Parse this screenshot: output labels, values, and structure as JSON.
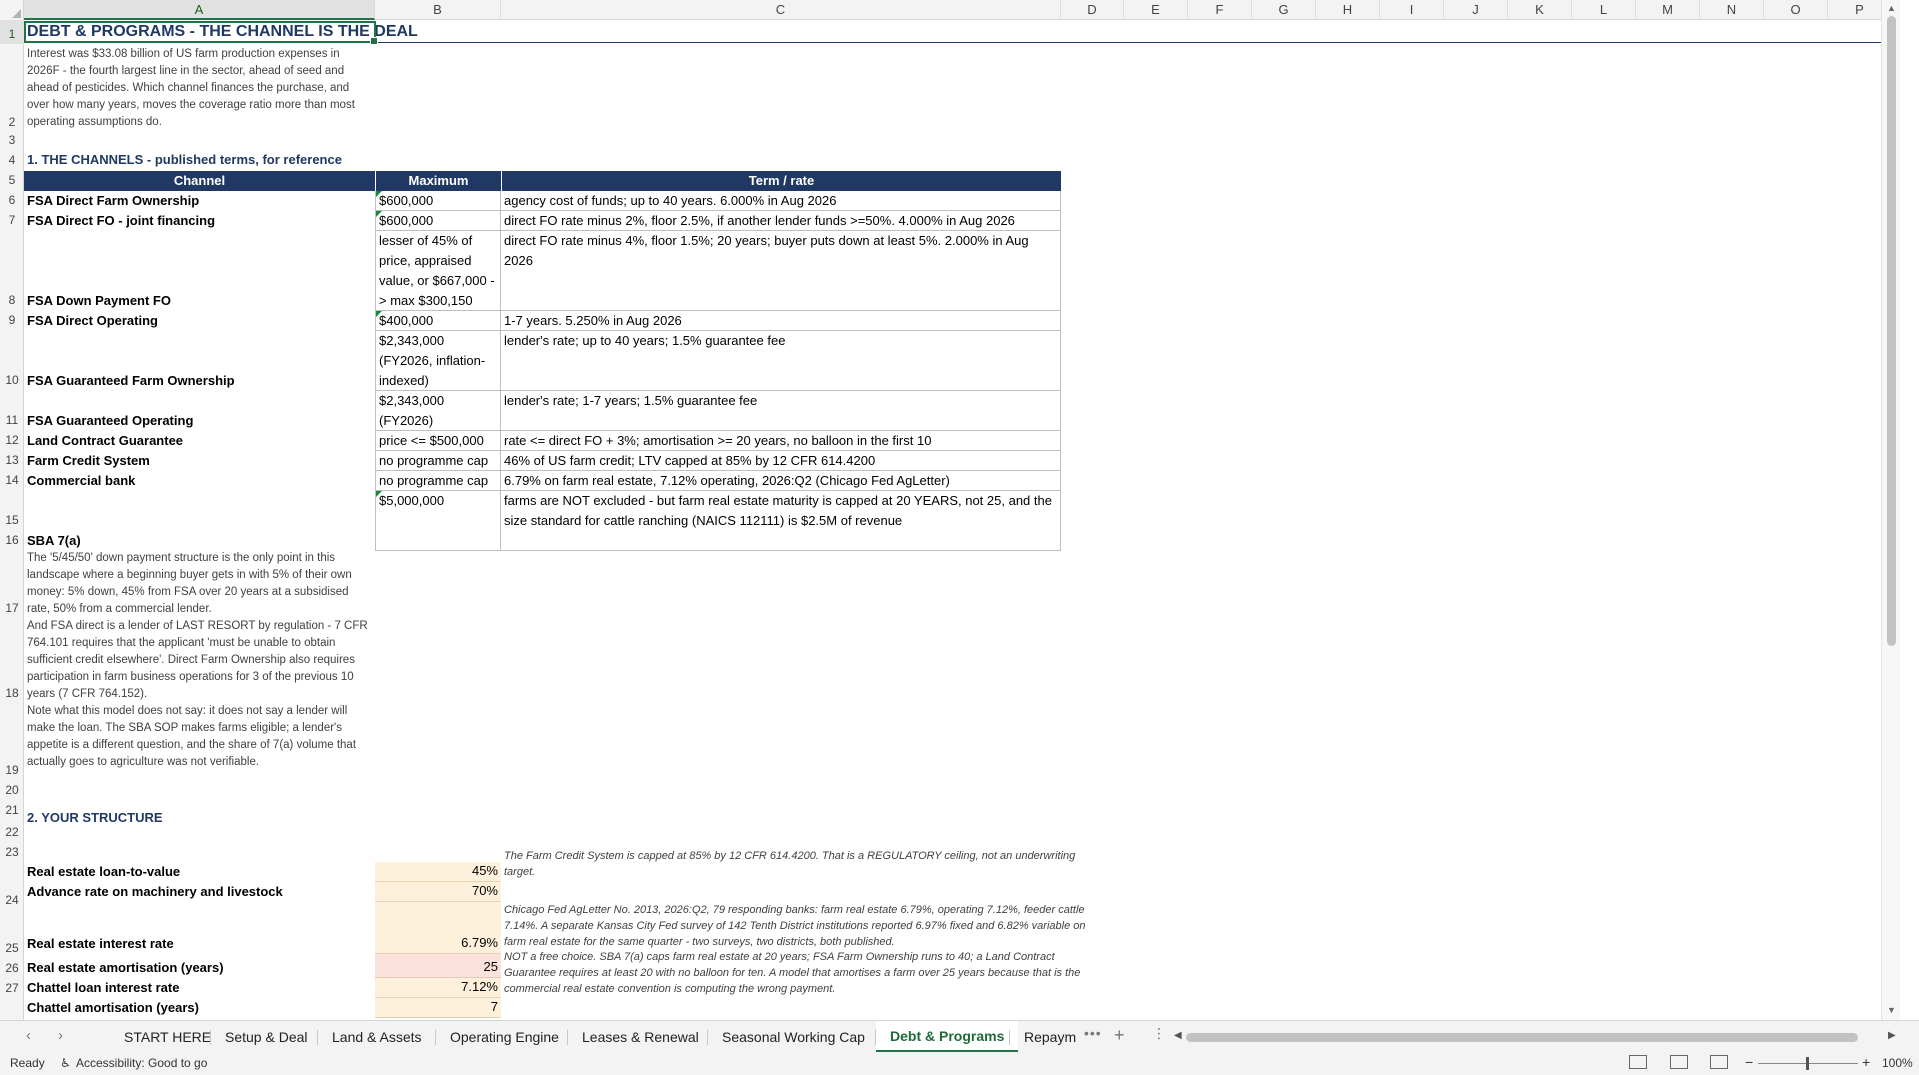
{
  "columns": [
    "A",
    "B",
    "C",
    "D",
    "E",
    "F",
    "G",
    "H",
    "I",
    "J",
    "K",
    "L",
    "M",
    "N",
    "O",
    "P"
  ],
  "rows": [
    "1",
    "2",
    "3",
    "4",
    "5",
    "6",
    "7",
    "8",
    "9",
    "10",
    "11",
    "12",
    "13",
    "14",
    "15",
    "16",
    "17",
    "18",
    "19",
    "20",
    "21",
    "22",
    "23",
    "24",
    "25",
    "26",
    "27"
  ],
  "title": "DEBT & PROGRAMS - THE CHANNEL IS THE DEAL",
  "intro": "Interest was $33.08 billion of US farm production expenses in 2026F - the fourth largest line in the sector, ahead of seed and ahead of pesticides. Which channel finances the purchase, and over how many years, moves the coverage ratio more than most operating assumptions do.",
  "section1": "1. THE CHANNELS - published terms, for reference",
  "table": {
    "headers": [
      "Channel",
      "Maximum",
      "Term / rate"
    ],
    "rows": [
      {
        "channel": "FSA Direct Farm Ownership",
        "max": "$600,000",
        "term": "agency cost of funds; up to 40 years. 6.000% in Aug 2026"
      },
      {
        "channel": "FSA Direct FO - joint financing",
        "max": "$600,000",
        "term": "direct FO rate minus 2%, floor 2.5%, if another lender funds >=50%. 4.000% in Aug 2026"
      },
      {
        "channel": "FSA Down Payment FO",
        "max": "lesser of 45% of price, appraised value, or $667,000 -> max $300,150",
        "term": "direct FO rate minus 4%, floor 1.5%; 20 years; buyer puts down at least 5%. 2.000% in Aug 2026"
      },
      {
        "channel": "FSA Direct Operating",
        "max": "$400,000",
        "term": "1-7 years. 5.250% in Aug 2026"
      },
      {
        "channel": "FSA Guaranteed Farm Ownership",
        "max": "$2,343,000 (FY2026, inflation-indexed)",
        "term": "lender's rate; up to 40 years; 1.5% guarantee fee"
      },
      {
        "channel": "FSA Guaranteed Operating",
        "max": "$2,343,000 (FY2026)",
        "term": "lender's rate; 1-7 years; 1.5% guarantee fee"
      },
      {
        "channel": "Land Contract Guarantee",
        "max": "price <= $500,000",
        "term": "rate <= direct FO + 3%; amortisation >= 20 years, no balloon in the first 10"
      },
      {
        "channel": "Farm Credit System",
        "max": "no programme cap",
        "term": "46% of US farm credit; LTV capped at 85% by 12 CFR 614.4200"
      },
      {
        "channel": "Commercial bank",
        "max": "no programme cap",
        "term": "6.79% on farm real estate, 7.12% operating, 2026:Q2 (Chicago Fed AgLetter)"
      },
      {
        "channel": "SBA 7(a)",
        "max": "$5,000,000",
        "term": "farms are NOT excluded - but farm real estate maturity is capped at 20 YEARS, not 25, and the size standard for cattle ranching (NAICS 112111) is $2.5M of revenue"
      }
    ]
  },
  "notes": {
    "r17": "The '5/45/50' down payment structure is the only point in this landscape where a beginning buyer gets in with 5% of their own money: 5% down, 45% from FSA over 20 years at a subsidised rate, 50% from a commercial lender.",
    "r18": "And FSA direct is a lender of LAST RESORT by regulation - 7 CFR 764.101 requires that the applicant 'must be unable to obtain sufficient credit elsewhere'. Direct Farm Ownership also requires participation in farm business operations for 3 of the previous 10 years (7 CFR 764.152).",
    "r19": "Note what this model does not say: it does not say a lender will make the loan. The SBA SOP makes farms eligible; a lender's appetite is a different question, and the share of 7(a) volume that actually goes to agriculture was not verifiable."
  },
  "section2": "2. YOUR STRUCTURE",
  "structure": [
    {
      "label": "Real estate loan-to-value",
      "value": "45%",
      "note": "The Farm Credit System is capped at 85% by 12 CFR 614.4200. That is a REGULATORY ceiling, not an underwriting target."
    },
    {
      "label": "Advance rate on machinery and livestock",
      "value": "70%",
      "note": ""
    },
    {
      "label": "Real estate interest rate",
      "value": "6.79%",
      "note": "Chicago Fed AgLetter No. 2013, 2026:Q2, 79 responding banks: farm real estate 6.79%, operating 7.12%, feeder cattle 7.14%. A separate Kansas City Fed survey of 142 Tenth District institutions reported 6.97% fixed and 6.82% variable on farm real estate for the same quarter - two surveys, two districts, both published."
    },
    {
      "label": "Real estate amortisation (years)",
      "value": "25",
      "note": "NOT a free choice. SBA 7(a) caps farm real estate at 20 years; FSA Farm Ownership runs to 40; a Land Contract Guarantee requires at least 20 with no balloon for ten. A model that amortises a farm over 25 years because that is the commercial real estate convention is computing the wrong payment."
    },
    {
      "label": "Chattel loan interest rate",
      "value": "7.12%",
      "note": ""
    },
    {
      "label": "Chattel amortisation (years)",
      "value": "7",
      "note": ""
    }
  ],
  "tabs": [
    "START HERE",
    "Setup & Deal",
    "Land & Assets",
    "Operating Engine",
    "Leases & Renewal",
    "Seasonal Working Cap",
    "Debt & Programs",
    "Repaym"
  ],
  "active_tab": "Debt & Programs",
  "status": {
    "ready": "Ready",
    "accessibility": "Accessibility: Good to go",
    "zoom": "100%"
  },
  "icons": {
    "prev": "chevron-left-icon",
    "next": "chevron-right-icon",
    "more": "ellipsis-icon",
    "add": "plus-icon"
  }
}
